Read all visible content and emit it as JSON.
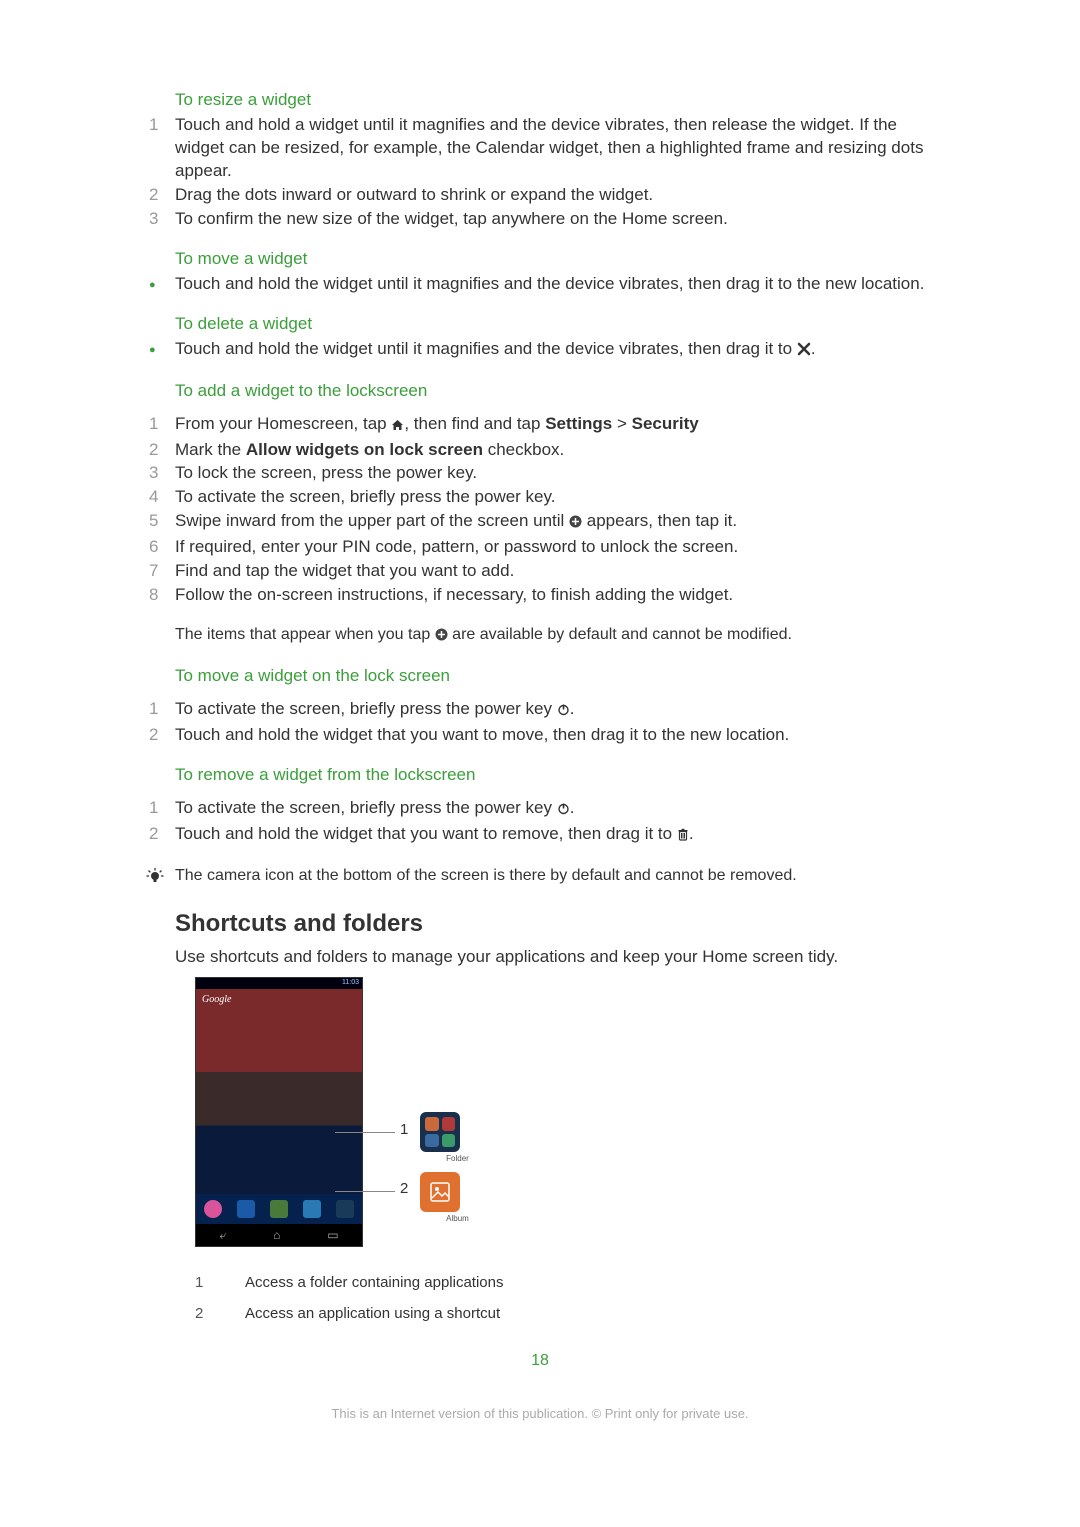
{
  "sections": {
    "resize": {
      "heading": "To resize a widget",
      "steps": [
        "Touch and hold a widget until it magnifies and the device vibrates, then release the widget. If the widget can be resized, for example, the Calendar widget, then a highlighted frame and resizing dots appear.",
        "Drag the dots inward or outward to shrink or expand the widget.",
        "To confirm the new size of the widget, tap anywhere on the Home screen."
      ]
    },
    "move": {
      "heading": "To move a widget",
      "bullet": "Touch and hold the widget until it magnifies and the device vibrates, then drag it to the new location."
    },
    "delete": {
      "heading": "To delete a widget",
      "bullet_pre": "Touch and hold the widget until it magnifies and the device vibrates, then drag it to ",
      "bullet_post": "."
    },
    "addlock": {
      "heading": "To add a widget to the lockscreen",
      "step1_pre": "From your Homescreen, tap ",
      "step1_mid": ", then find and tap ",
      "step1_b1": "Settings",
      "step1_gt": " > ",
      "step1_b2": "Security",
      "step2_pre": "Mark the ",
      "step2_b": "Allow widgets on lock screen",
      "step2_post": " checkbox.",
      "step3": "To lock the screen, press the power key.",
      "step4": "To activate the screen, briefly press the power key.",
      "step5_pre": "Swipe inward from the upper part of the screen until ",
      "step5_post": " appears, then tap it.",
      "step6": "If required, enter your PIN code, pattern, or password to unlock the screen.",
      "step7": "Find and tap the widget that you want to add.",
      "step8": "Follow the on-screen instructions, if necessary, to finish adding the widget.",
      "note_pre": "The items that appear when you tap ",
      "note_post": " are available by default and cannot be modified."
    },
    "movelock": {
      "heading": "To move a widget on the lock screen",
      "step1_pre": "To activate the screen, briefly press the power key ",
      "step1_post": ".",
      "step2": "Touch and hold the widget that you want to move, then drag it to the new location."
    },
    "removelock": {
      "heading": "To remove a widget from the lockscreen",
      "step1_pre": "To activate the screen, briefly press the power key ",
      "step1_post": ".",
      "step2_pre": "Touch and hold the widget that you want to remove, then drag it to ",
      "step2_post": ".",
      "tip": "The camera icon at the bottom of the screen is there by default and cannot be removed."
    },
    "shortcuts": {
      "heading": "Shortcuts and folders",
      "intro": "Use shortcuts and folders to manage your applications and keep your Home screen tidy.",
      "legend1": "Access a folder containing applications",
      "legend2": "Access an application using a shortcut"
    }
  },
  "phone": {
    "time": "11:03",
    "google": "Google",
    "folder_label": "Folder",
    "album_label": "Album",
    "callout1": "1",
    "callout2": "2"
  },
  "legend_nums": {
    "n1": "1",
    "n2": "2"
  },
  "step_nums": {
    "n1": "1",
    "n2": "2",
    "n3": "3",
    "n4": "4",
    "n5": "5",
    "n6": "6",
    "n7": "7",
    "n8": "8"
  },
  "page": "18",
  "footer": "This is an Internet version of this publication. © Print only for private use."
}
